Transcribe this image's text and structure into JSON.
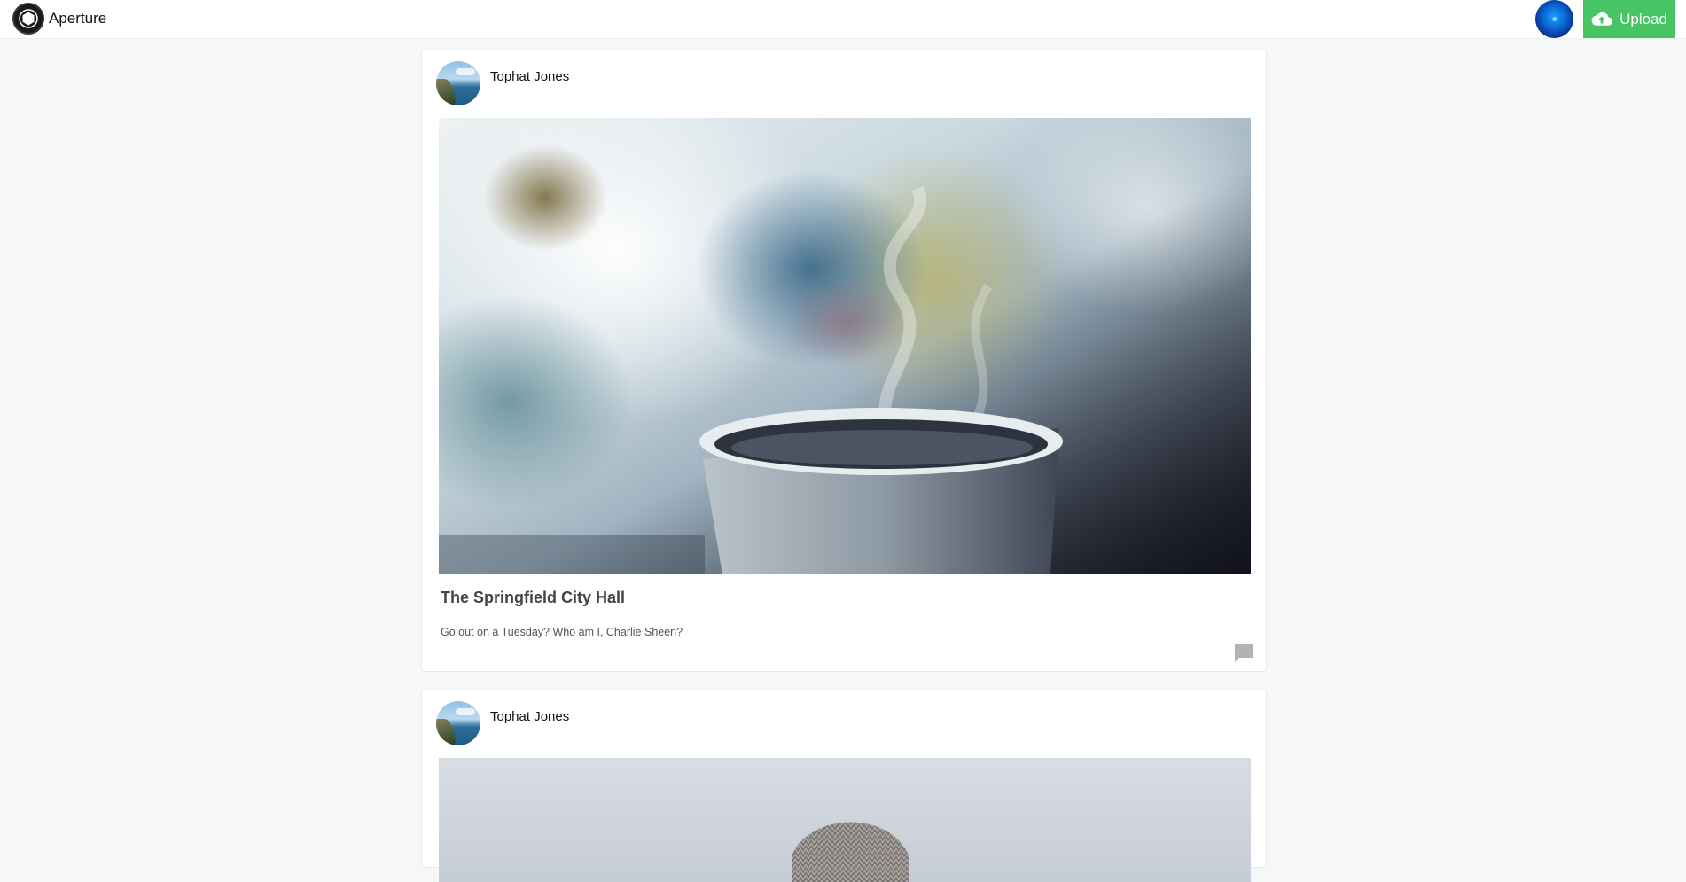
{
  "app": {
    "brand_name": "Aperture",
    "logo_icon": "aperture-hexagon-icon"
  },
  "header": {
    "profile_icon": "user-avatar-orb-icon",
    "upload_label": "Upload",
    "upload_icon": "cloud-upload-icon",
    "accent_color": "#47c463"
  },
  "feed": {
    "posts": [
      {
        "author": "Tophat Jones",
        "title": "The Springfield City Hall",
        "description": "Go out on a Tuesday? Who am I, Charlie Sheen?",
        "image": "steaming-cup-photo",
        "comment_icon": "comment-icon"
      },
      {
        "author": "Tophat Jones",
        "image": "knit-beanie-photo"
      }
    ]
  }
}
